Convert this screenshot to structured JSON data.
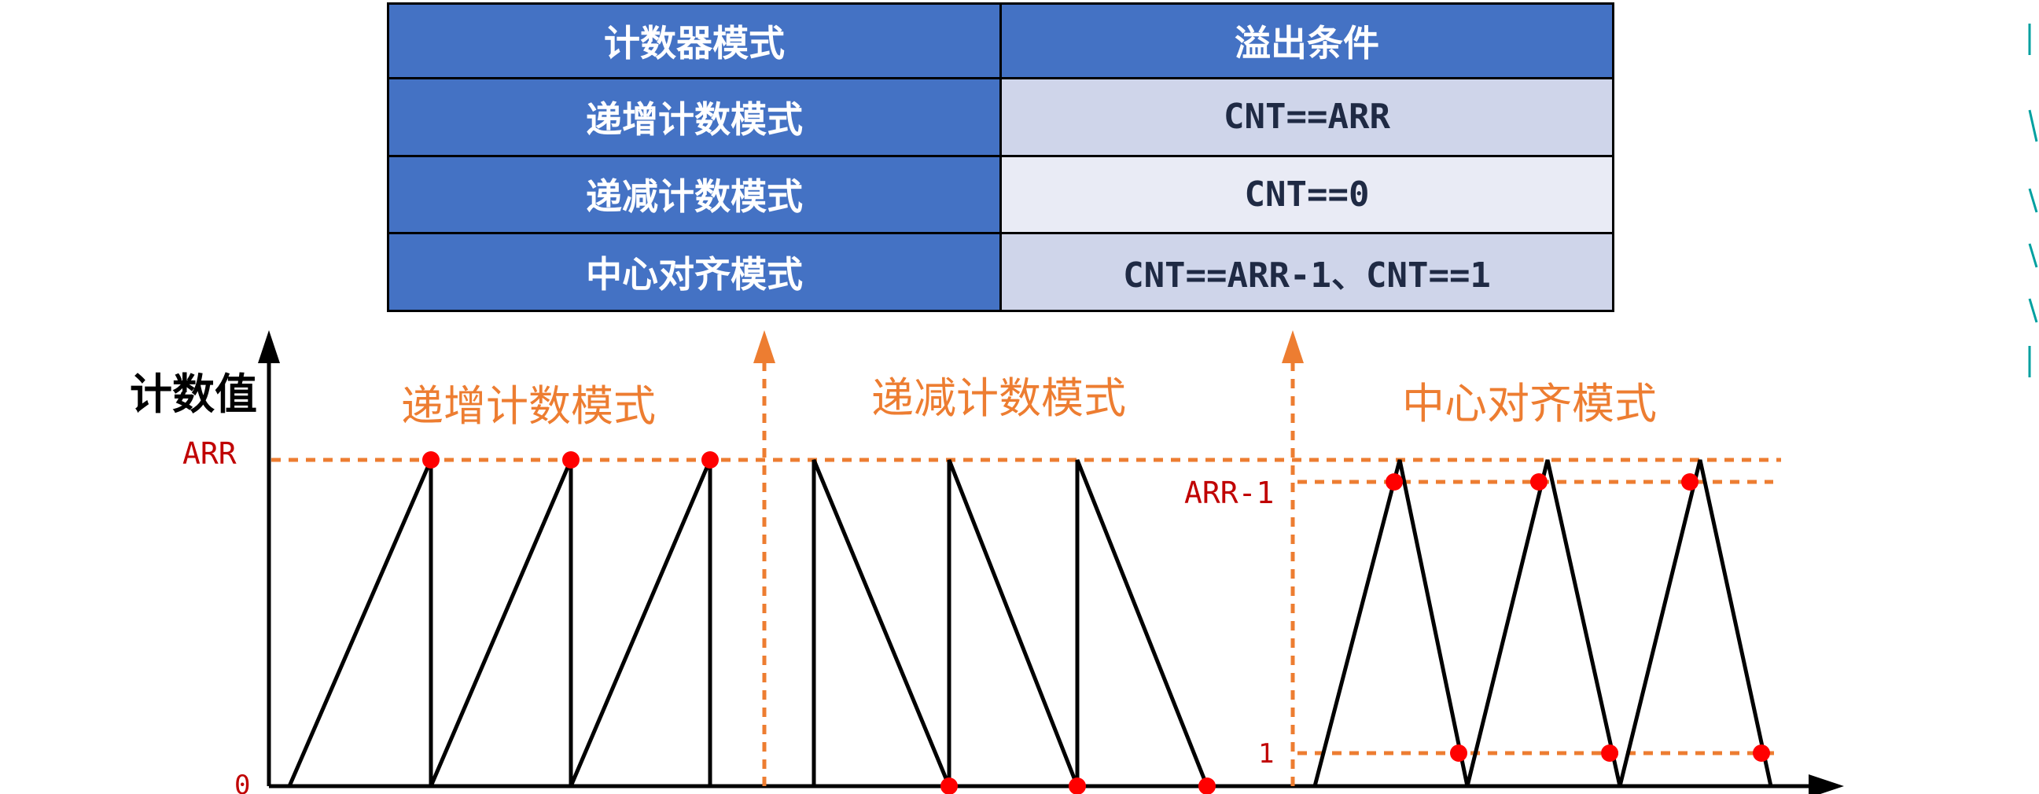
{
  "table": {
    "headers": [
      "计数器模式",
      "溢出条件"
    ],
    "rows": [
      {
        "mode": "递增计数模式",
        "condition": "CNT==ARR"
      },
      {
        "mode": "递减计数模式",
        "condition": "CNT==0"
      },
      {
        "mode": "中心对齐模式",
        "condition": "CNT==ARR-1、CNT==1"
      }
    ]
  },
  "diagram": {
    "y_axis_label": "计数值",
    "levels": {
      "arr": "ARR",
      "zero": "0",
      "arr_minus_1": "ARR-1",
      "one": "1"
    },
    "sections": {
      "up": "递增计数模式",
      "down": "递减计数模式",
      "center": "中心对齐模式"
    }
  },
  "colors": {
    "header_blue": "#4472c4",
    "orange": "#ed7d31",
    "blue_dash": "#4472c4",
    "red": "#ff0000",
    "dark_red_text": "#c00000"
  }
}
